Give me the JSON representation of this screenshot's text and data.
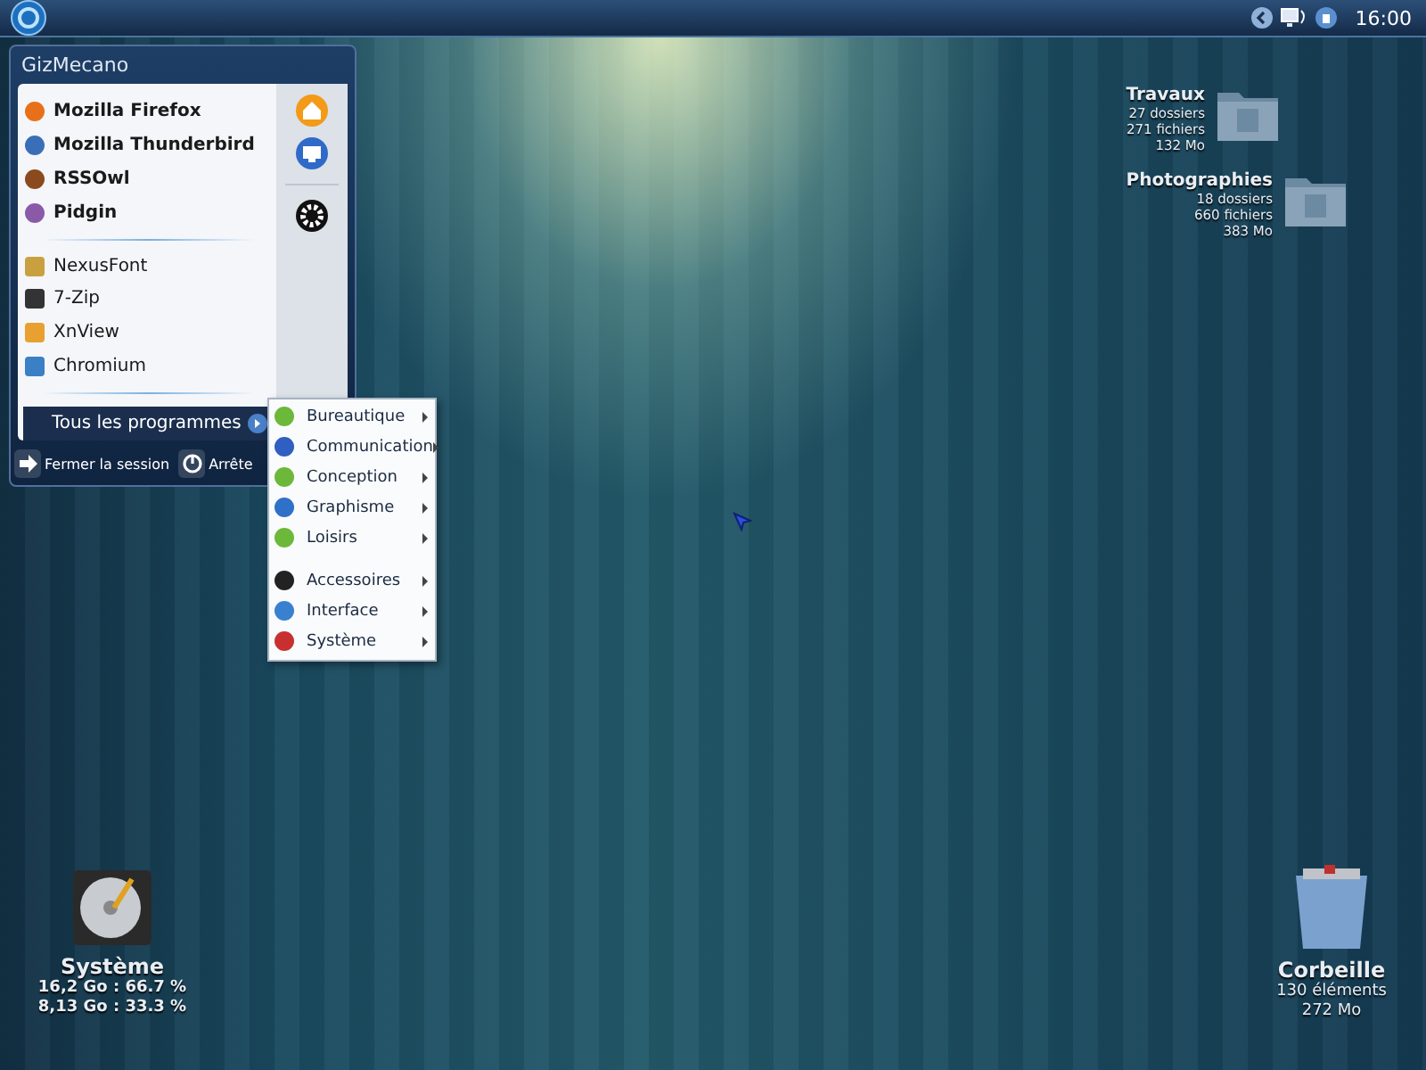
{
  "taskbar": {
    "clock": "16:00"
  },
  "start_menu": {
    "user": "GizMecano",
    "pinned": [
      {
        "label": "Mozilla Firefox"
      },
      {
        "label": "Mozilla Thunderbird"
      },
      {
        "label": "RSSOwl"
      },
      {
        "label": "Pidgin"
      }
    ],
    "recent": [
      {
        "label": "NexusFont"
      },
      {
        "label": "7-Zip"
      },
      {
        "label": "XnView"
      },
      {
        "label": "Chromium"
      }
    ],
    "all_programs": "Tous les programmes",
    "session_buttons": [
      {
        "label": "Fermer la session"
      },
      {
        "label": "Arrête"
      }
    ]
  },
  "submenu": {
    "groups": [
      [
        {
          "label": "Bureautique"
        },
        {
          "label": "Communication"
        },
        {
          "label": "Conception"
        },
        {
          "label": "Graphisme"
        },
        {
          "label": "Loisirs"
        }
      ],
      [
        {
          "label": "Accessoires"
        },
        {
          "label": "Interface"
        },
        {
          "label": "Système"
        }
      ]
    ]
  },
  "folders": [
    {
      "name": "Travaux",
      "lines": [
        "27 dossiers",
        "271 fichiers",
        "132 Mo"
      ]
    },
    {
      "name": "Photographies",
      "lines": [
        "18 dossiers",
        "660 fichiers",
        "383 Mo"
      ]
    }
  ],
  "drive": {
    "name": "Système",
    "lines": [
      "16,2 Go : 66.7 %",
      "8,13 Go : 33.3 %"
    ]
  },
  "trash": {
    "name": "Corbeille",
    "lines": [
      "130 éléments",
      "272 Mo"
    ]
  }
}
